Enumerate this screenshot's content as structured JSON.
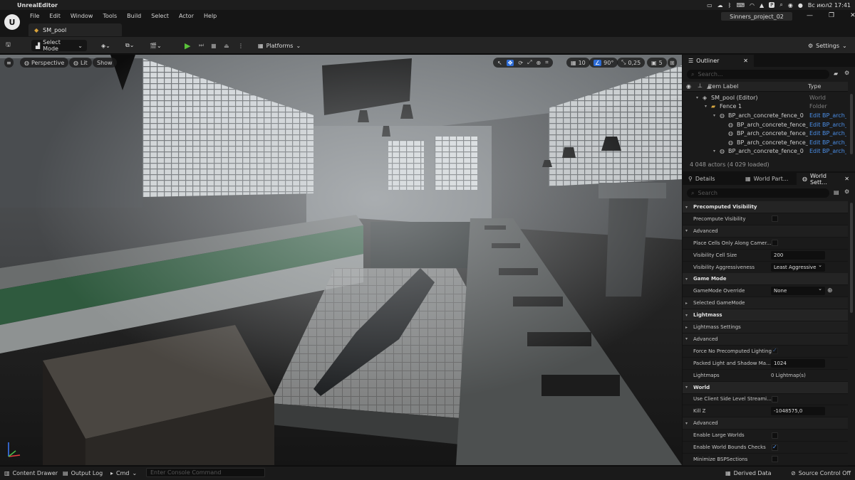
{
  "mac": {
    "app_name": "UnrealEditor",
    "menus": [
      "File",
      "Edit",
      "Window",
      "Tools",
      "Build",
      "Select",
      "Actor",
      "Help"
    ],
    "clock": "Вс июл2 17:41",
    "status_letter": "P"
  },
  "editor": {
    "level_tab": "SM_pool",
    "project_name": "Sinners_project_02",
    "toolbar": {
      "select_mode": "Select Mode",
      "platforms": "Platforms",
      "settings": "Settings"
    }
  },
  "viewport": {
    "perspective": "Perspective",
    "lit": "Lit",
    "show": "Show",
    "grid_snap": "10",
    "rotation_snap": "90°",
    "scale_snap": "0,25",
    "camera_speed": "5"
  },
  "outliner": {
    "tab_title": "Outliner",
    "search_placeholder": "Search...",
    "col_label": "Item Label",
    "col_type": "Type",
    "rows": [
      {
        "label": "SM_pool (Editor)",
        "type": "World",
        "indent": 0
      },
      {
        "label": "Fence 1",
        "type": "Folder",
        "indent": 1
      },
      {
        "label": "BP_arch_concrete_fence_0",
        "type": "Edit BP_arch_c",
        "indent": 2
      },
      {
        "label": "BP_arch_concrete_fence_",
        "type": "Edit BP_arch_c",
        "indent": 3
      },
      {
        "label": "BP_arch_concrete_fence_",
        "type": "Edit BP_arch_c",
        "indent": 3
      },
      {
        "label": "BP_arch_concrete_fence_",
        "type": "Edit BP_arch_c",
        "indent": 3
      },
      {
        "label": "BP_arch_concrete_fence_0",
        "type": "Edit BP_arch_c",
        "indent": 2
      }
    ],
    "actor_count": "4 048 actors (4 029 loaded)"
  },
  "details": {
    "tabs": [
      "Details",
      "World Part...",
      "World Sett..."
    ],
    "search_placeholder": "Search",
    "rows": [
      {
        "kind": "cat",
        "label": "Precomputed Visibility"
      },
      {
        "kind": "prop",
        "label": "Precompute Visibility",
        "check": false
      },
      {
        "kind": "sub",
        "label": "Advanced"
      },
      {
        "kind": "prop",
        "label": "Place Cells Only Along Camer...",
        "check": false
      },
      {
        "kind": "prop",
        "label": "Visibility Cell Size",
        "value": "200"
      },
      {
        "kind": "prop",
        "label": "Visibility Aggressiveness",
        "dropdown": "Least Aggressive"
      },
      {
        "kind": "cat",
        "label": "Game Mode"
      },
      {
        "kind": "prop",
        "label": "GameMode Override",
        "dropdown": "None"
      },
      {
        "kind": "sub",
        "label": "Selected GameMode"
      },
      {
        "kind": "cat",
        "label": "Lightmass"
      },
      {
        "kind": "sub",
        "label": "Lightmass Settings"
      },
      {
        "kind": "sub",
        "label": "Advanced"
      },
      {
        "kind": "prop",
        "label": "Force No Precomputed Lighting",
        "check": true,
        "disabled": true
      },
      {
        "kind": "prop",
        "label": "Packed Light and Shadow Ma...",
        "value": "1024"
      },
      {
        "kind": "prop",
        "label": "Lightmaps",
        "text": "0 Lightmap(s)"
      },
      {
        "kind": "cat",
        "label": "World"
      },
      {
        "kind": "prop",
        "label": "Use Client Side Level Streami...",
        "check": false
      },
      {
        "kind": "prop",
        "label": "Kill Z",
        "value": "-1048575,0"
      },
      {
        "kind": "sub",
        "label": "Advanced"
      },
      {
        "kind": "prop",
        "label": "Enable Large Worlds",
        "check": false
      },
      {
        "kind": "prop",
        "label": "Enable World Bounds Checks",
        "check": true
      },
      {
        "kind": "prop",
        "label": "Minimize BSPSections",
        "check": false
      }
    ]
  },
  "statusbar": {
    "content_drawer": "Content Drawer",
    "output_log": "Output Log",
    "cmd": "Cmd",
    "console_placeholder": "Enter Console Command",
    "derived_data": "Derived Data",
    "source_control": "Source Control Off"
  }
}
